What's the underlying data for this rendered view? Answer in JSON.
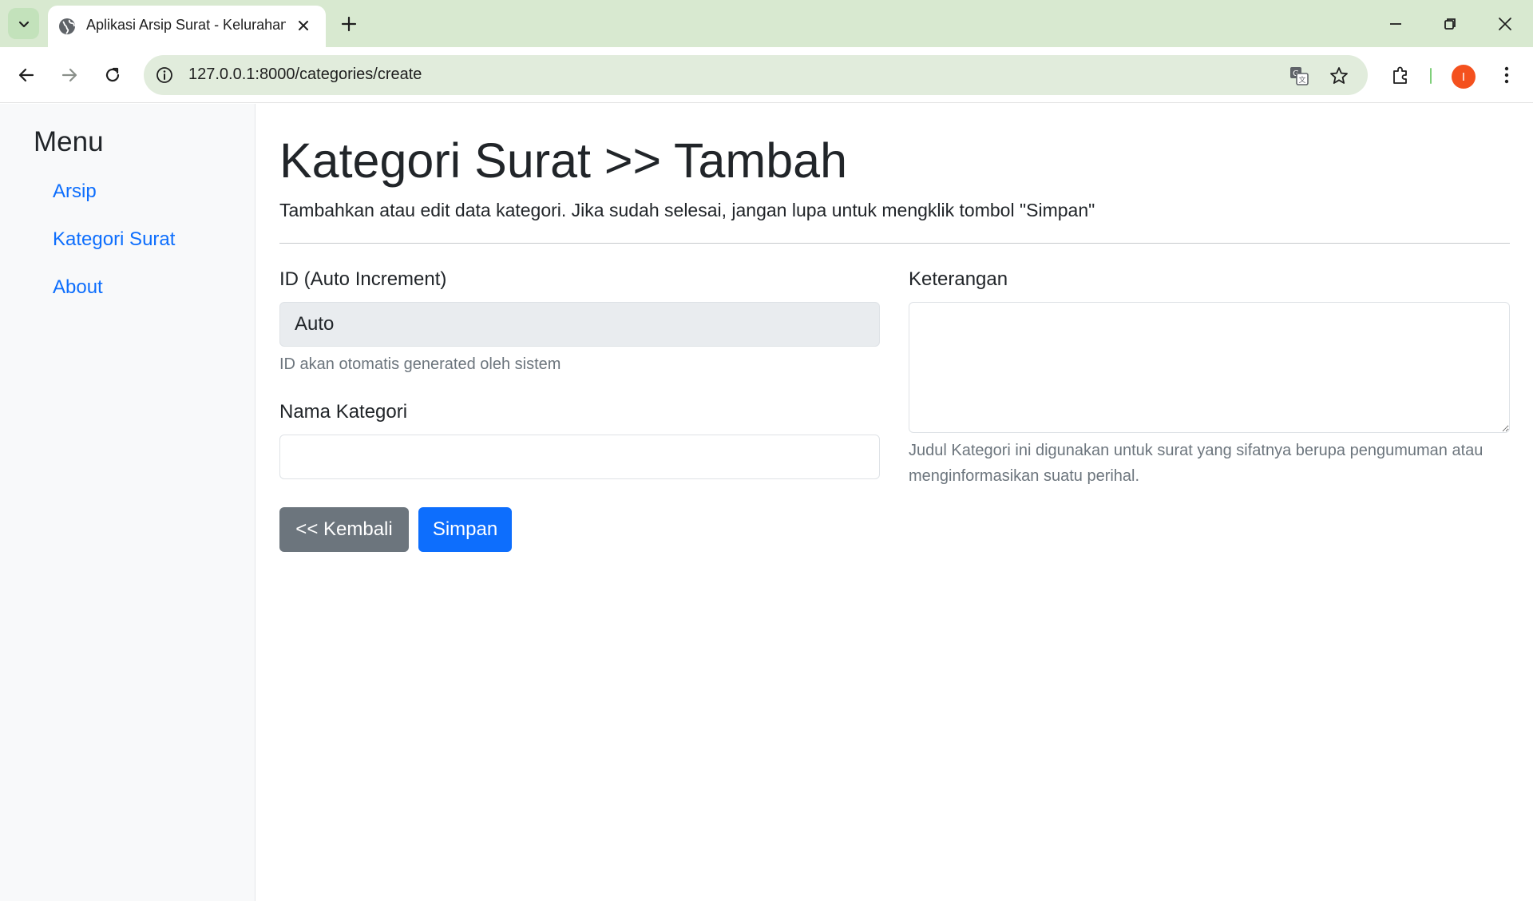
{
  "browser": {
    "tab_title": "Aplikasi Arsip Surat - Kelurahan",
    "url": "127.0.0.1:8000/categories/create",
    "avatar_initial": "I",
    "accent": "#d8e9d0",
    "avatar_color": "#f4511e",
    "icons": [
      "tab-search-icon",
      "globe-icon",
      "close-icon",
      "plus-icon",
      "minimize-icon",
      "restore-icon",
      "close-window-icon",
      "back-arrow-icon",
      "forward-arrow-icon",
      "reload-icon",
      "info-icon",
      "translate-icon",
      "star-icon",
      "extensions-icon",
      "kebab-menu-icon"
    ]
  },
  "sidebar": {
    "title": "Menu",
    "items": [
      {
        "label": "Arsip"
      },
      {
        "label": "Kategori Surat"
      },
      {
        "label": "About"
      }
    ],
    "link_color": "#0d6efd"
  },
  "page": {
    "title": "Kategori Surat >> Tambah",
    "subtitle": "Tambahkan atau edit data kategori. Jika sudah selesai, jangan lupa untuk mengklik tombol \"Simpan\""
  },
  "form": {
    "id_label": "ID (Auto Increment)",
    "id_value": "Auto",
    "id_help": "ID akan otomatis generated oleh sistem",
    "name_label": "Nama Kategori",
    "name_value": "",
    "desc_label": "Keterangan",
    "desc_value": "",
    "desc_help": "Judul Kategori ini digunakan untuk surat yang sifatnya berupa pengumuman atau menginformasikan suatu perihal."
  },
  "actions": {
    "back_label": "<< Kembali",
    "save_label": "Simpan",
    "primary_color": "#0d6efd",
    "secondary_color": "#6c757d"
  }
}
